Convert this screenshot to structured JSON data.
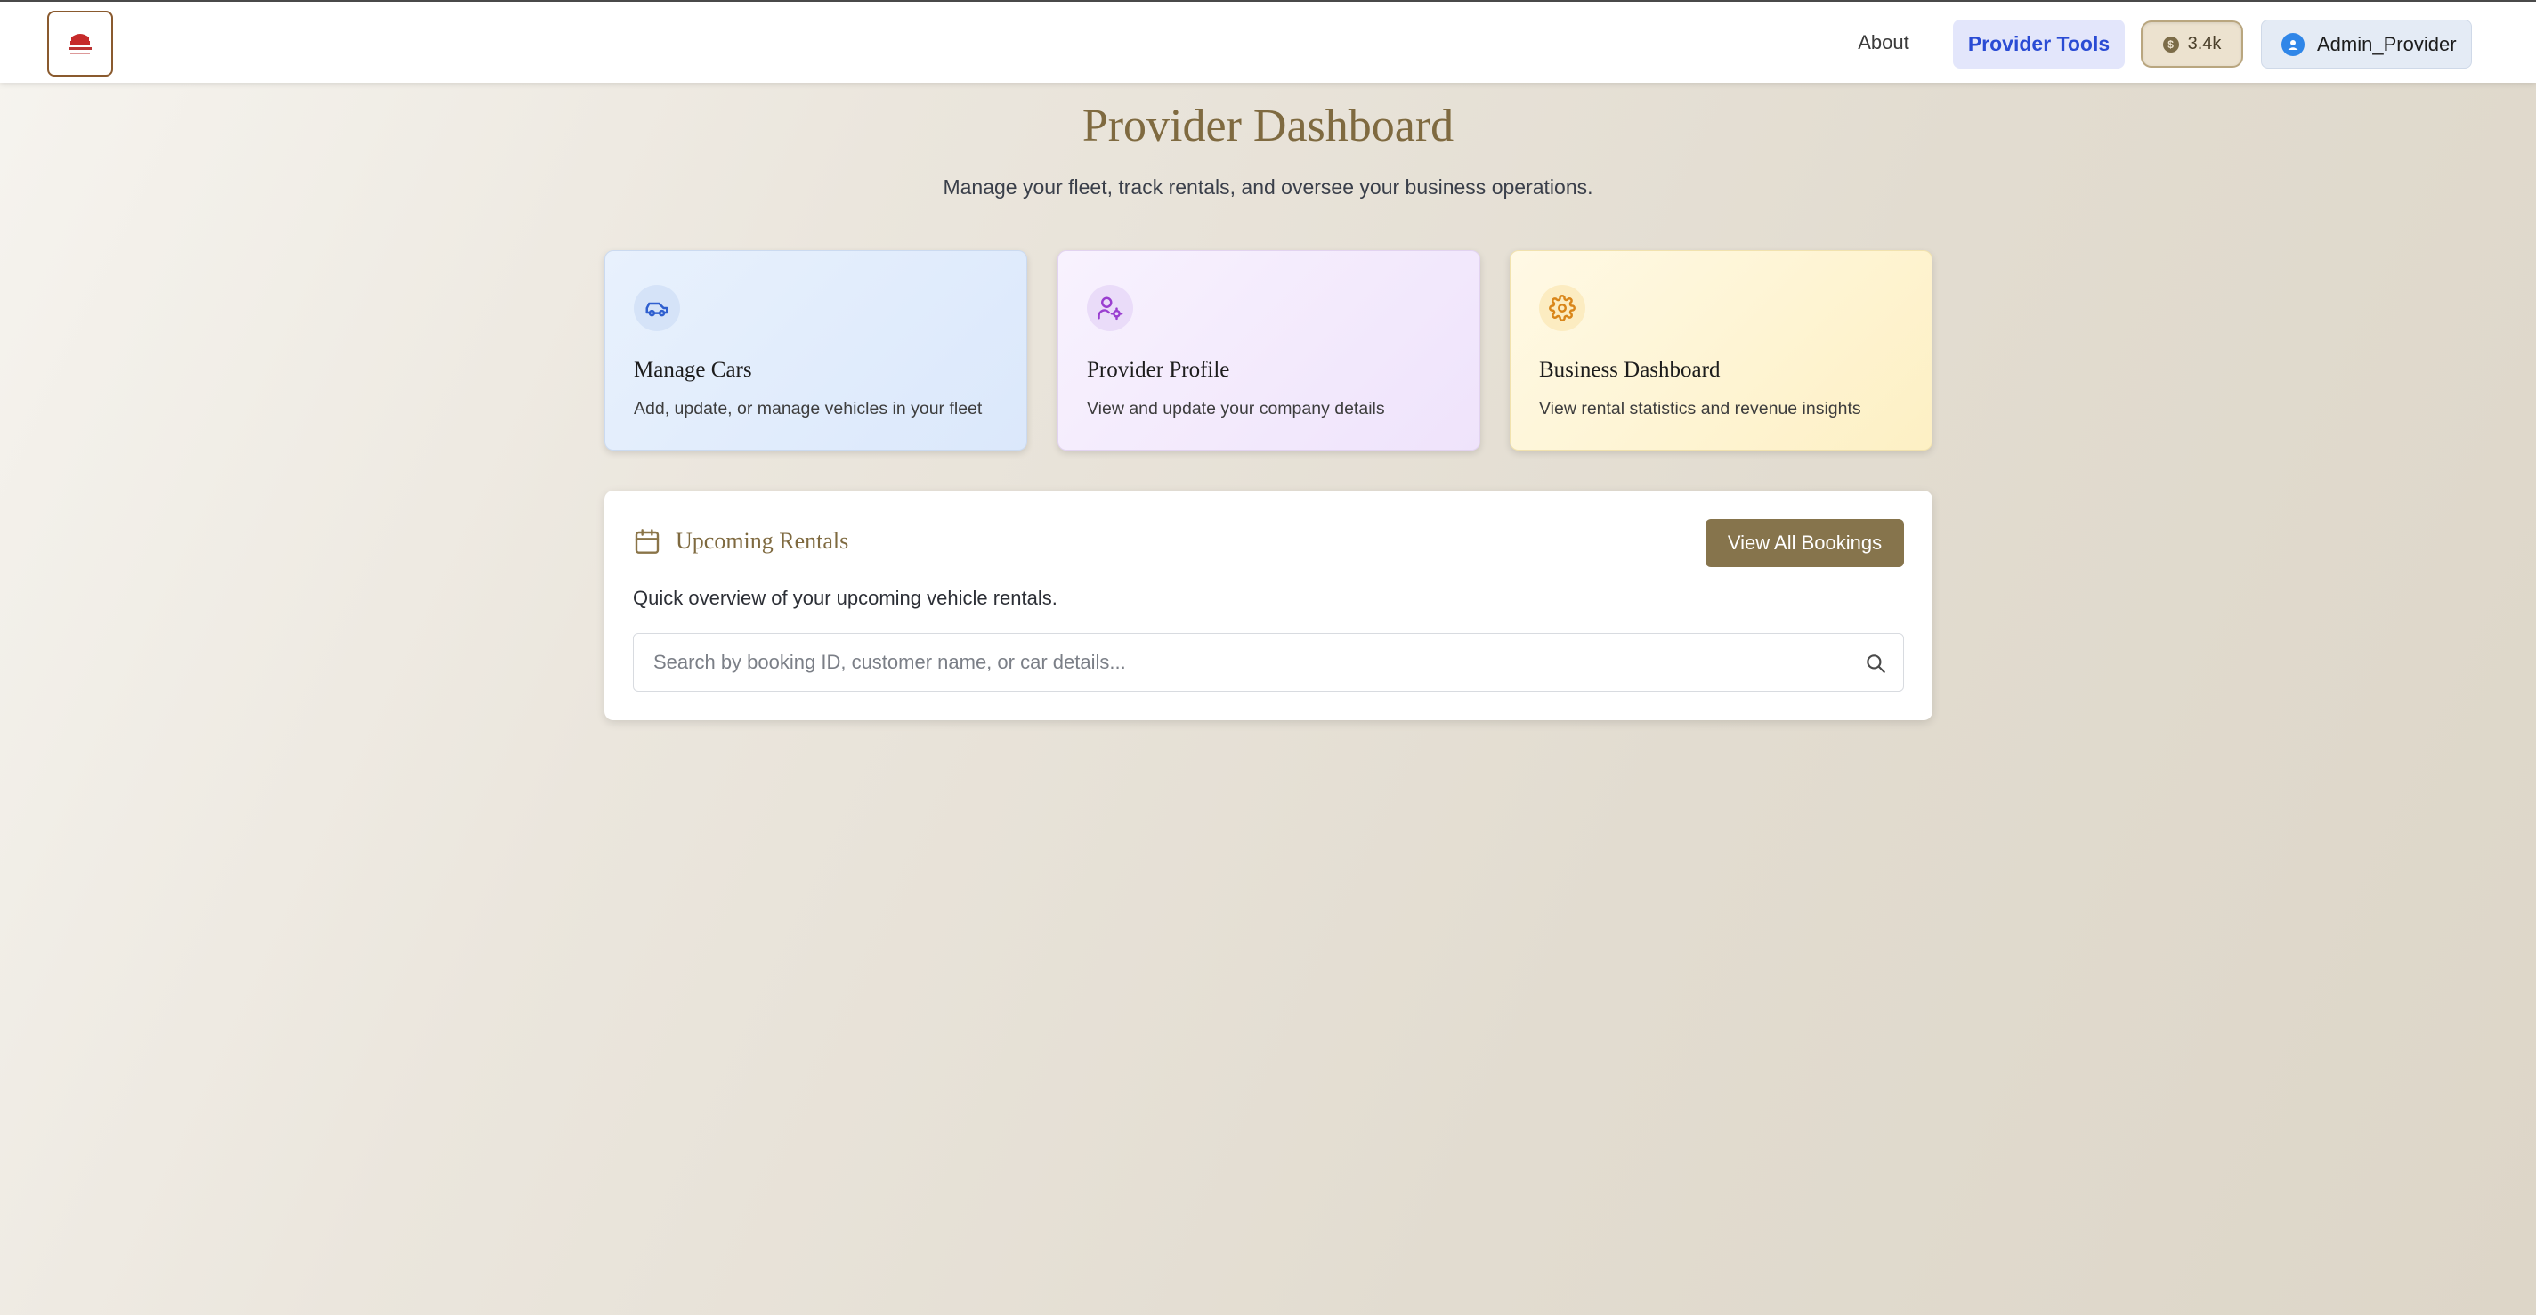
{
  "nav": {
    "about": "About",
    "provider_tools": "Provider Tools",
    "credits": "3.4k",
    "credits_coin": "$",
    "username": "Admin_Provider"
  },
  "header": {
    "title": "Provider Dashboard",
    "subtitle": "Manage your fleet, track rentals, and oversee your business operations."
  },
  "cards": [
    {
      "title": "Manage Cars",
      "description": "Add, update, or manage vehicles in your fleet",
      "icon": "car-icon",
      "accent": "#2f5fcf"
    },
    {
      "title": "Provider Profile",
      "description": "View and update your company details",
      "icon": "user-cog-icon",
      "accent": "#9a3fd0"
    },
    {
      "title": "Business Dashboard",
      "description": "View rental statistics and revenue insights",
      "icon": "gear-icon",
      "accent": "#d9861a"
    }
  ],
  "rentals": {
    "title": "Upcoming Rentals",
    "view_all": "View All Bookings",
    "description": "Quick overview of your upcoming vehicle rentals.",
    "search_placeholder": "Search by booking ID, customer name, or car details..."
  },
  "colors": {
    "brand_gold": "#7f6a40",
    "button_brown": "#86744c",
    "accent_blue": "#2a4bd4"
  }
}
